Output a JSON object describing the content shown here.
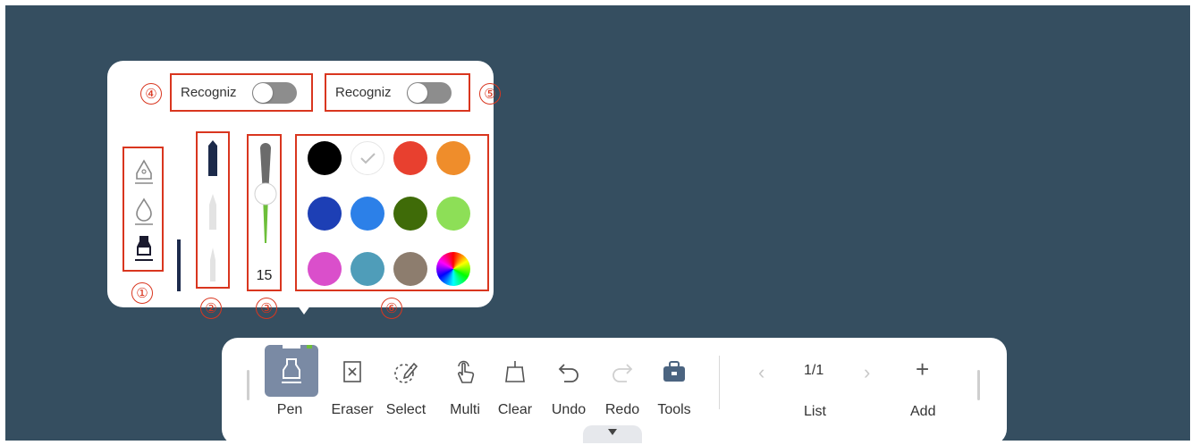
{
  "popup": {
    "toggle_left": {
      "label": "Recogniz",
      "state": "off"
    },
    "toggle_right": {
      "label": "Recogniz",
      "state": "off"
    },
    "markers": [
      "①",
      "②",
      "③",
      "④",
      "⑤",
      "⑥"
    ],
    "pen_types": [
      "fountain-pen-icon",
      "soft-pen-icon",
      "highlighter-pen-icon"
    ],
    "pen_styles": [
      "marker-nib-icon",
      "pencil-tip-icon",
      "brush-tip-icon"
    ],
    "thickness": {
      "value": "15"
    },
    "colors": [
      "#000000",
      "#ffffff",
      "#e8402f",
      "#ef8d2b",
      "#1d3fb5",
      "#2c80e8",
      "#3f6b08",
      "#8ddf57",
      "#da4fcb",
      "#4f9db9",
      "#8d7d6e",
      "rainbow"
    ],
    "selected_color_index": 1
  },
  "toolbar": {
    "tools": [
      {
        "label": "Pen",
        "icon": "pen-icon"
      },
      {
        "label": "Eraser",
        "icon": "eraser-icon"
      },
      {
        "label": "Select",
        "icon": "select-icon"
      },
      {
        "label": "Multi",
        "icon": "multi-touch-icon"
      },
      {
        "label": "Clear",
        "icon": "clear-icon"
      },
      {
        "label": "Undo",
        "icon": "undo-icon"
      },
      {
        "label": "Redo",
        "icon": "redo-icon"
      },
      {
        "label": "Tools",
        "icon": "toolbox-icon"
      }
    ],
    "page_indicator": "1/1",
    "list_label": "List",
    "add_label": "Add",
    "add_symbol": "+",
    "prev_symbol": "‹",
    "next_symbol": "›"
  }
}
